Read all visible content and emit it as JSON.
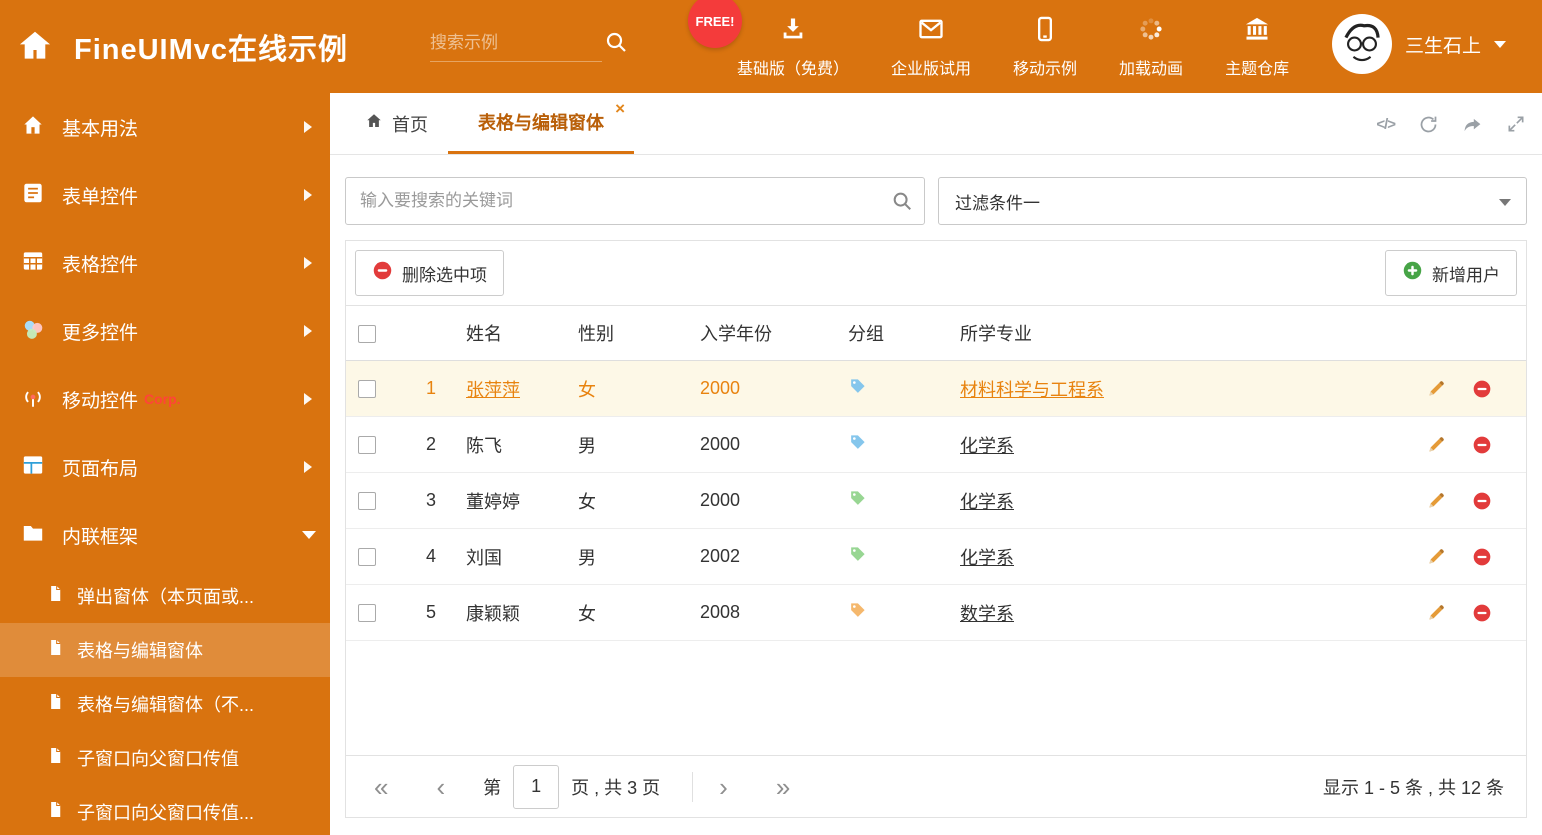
{
  "header": {
    "title": "FineUIMvc在线示例",
    "search_placeholder": "搜索示例",
    "free_badge": "FREE!",
    "nav": [
      {
        "label": "基础版（免费）",
        "icon": "download-icon"
      },
      {
        "label": "企业版试用",
        "icon": "envelope-icon"
      },
      {
        "label": "移动示例",
        "icon": "mobile-icon"
      },
      {
        "label": "加载动画",
        "icon": "spinner-icon"
      },
      {
        "label": "主题仓库",
        "icon": "bank-icon"
      }
    ],
    "user_name": "三生石上"
  },
  "sidebar": {
    "items": [
      {
        "label": "基本用法"
      },
      {
        "label": "表单控件"
      },
      {
        "label": "表格控件"
      },
      {
        "label": "更多控件"
      },
      {
        "label": "移动控件",
        "badge": "Corp."
      },
      {
        "label": "页面布局"
      },
      {
        "label": "内联框架"
      }
    ],
    "subitems": [
      {
        "label": "弹出窗体（本页面或...",
        "state": ""
      },
      {
        "label": "表格与编辑窗体",
        "state": "active"
      },
      {
        "label": "表格与编辑窗体（不...",
        "state": ""
      },
      {
        "label": "子窗口向父窗口传值",
        "state": ""
      },
      {
        "label": "子窗口向父窗口传值...",
        "state": ""
      }
    ]
  },
  "tabs": {
    "home": "首页",
    "active": "表格与编辑窗体",
    "close": "×"
  },
  "filter": {
    "search_placeholder": "输入要搜索的关键词",
    "dropdown_value": "过滤条件一"
  },
  "toolbar": {
    "delete_label": "删除选中项",
    "add_label": "新增用户"
  },
  "grid": {
    "headers": [
      "姓名",
      "性别",
      "入学年份",
      "分组",
      "所学专业"
    ],
    "rows": [
      {
        "num": "1",
        "name": "张萍萍",
        "gender": "女",
        "year": "2000",
        "tag_class": "tag-blue",
        "major": "材料科学与工程系",
        "row_class": "row-hl"
      },
      {
        "num": "2",
        "name": "陈飞",
        "gender": "男",
        "year": "2000",
        "tag_class": "tag-blue",
        "major": "化学系",
        "row_class": ""
      },
      {
        "num": "3",
        "name": "董婷婷",
        "gender": "女",
        "year": "2000",
        "tag_class": "tag-green",
        "major": "化学系",
        "row_class": ""
      },
      {
        "num": "4",
        "name": "刘国",
        "gender": "男",
        "year": "2002",
        "tag_class": "tag-green",
        "major": "化学系",
        "row_class": ""
      },
      {
        "num": "5",
        "name": "康颖颖",
        "gender": "女",
        "year": "2008",
        "tag_class": "tag-orange",
        "major": "数学系",
        "row_class": ""
      }
    ]
  },
  "pagination": {
    "first": "«",
    "prev": "‹",
    "page_label_before": "第",
    "current_page": "1",
    "page_label_after": "页 , 共 3 页",
    "next": "›",
    "last": "»",
    "summary": "显示 1 - 5 条 , 共 12 条"
  },
  "colors": {
    "theme_orange": "#d9730f",
    "badge_red": "#f43b3b",
    "delete_red": "#e23b3b",
    "add_green": "#47a447",
    "tag_blue": "#85c6ec",
    "tag_green": "#98d693",
    "tag_orange": "#f5b86d",
    "highlight_row_bg": "#fdf8e7",
    "link_orange": "#e8830f"
  }
}
